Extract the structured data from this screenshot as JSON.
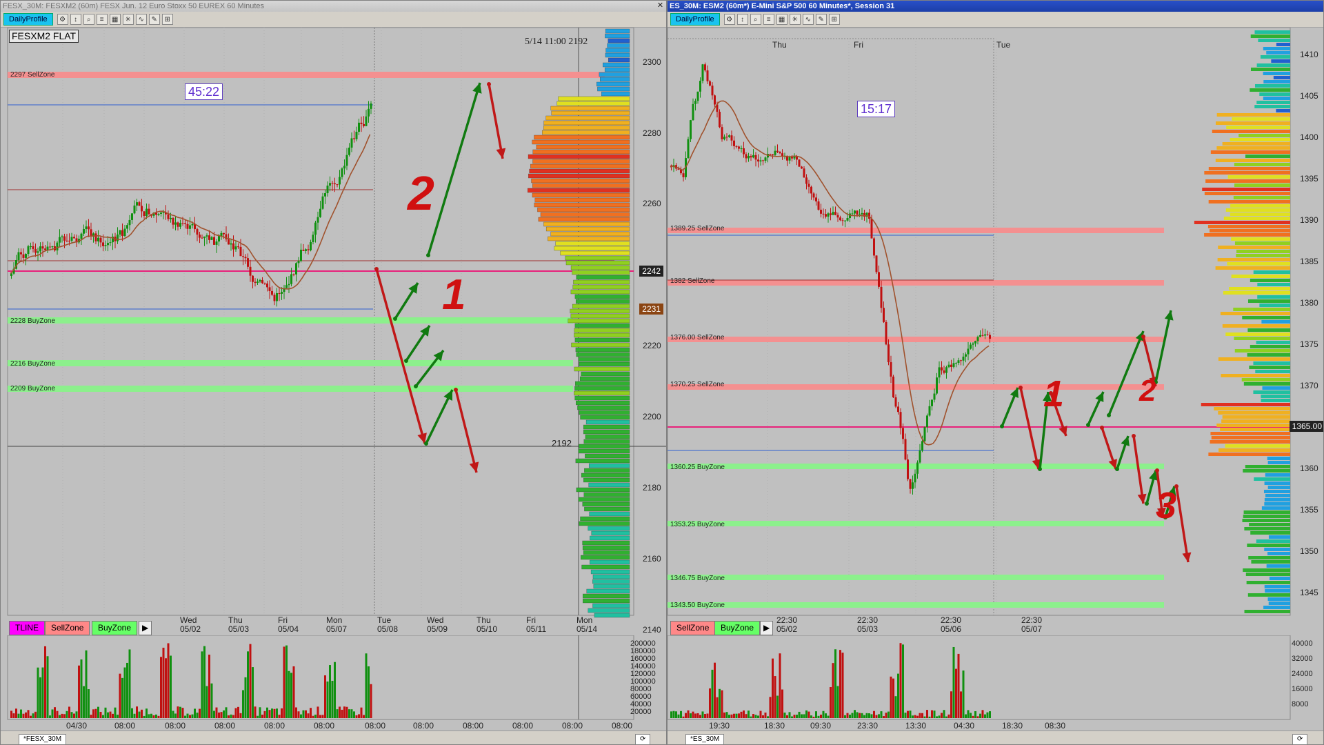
{
  "left": {
    "title": "FESX_30M: FESXM2 (60m) FESX Jun. 12 Euro Stoxx 50 EUREX 60 Minutes",
    "profile_button": "DailyProfile",
    "symbol_label": "FESXM2 FLAT",
    "countdown": "45:22",
    "cursor_readout": "5/14 11:00  2192",
    "cursor_price": "2192",
    "current_price_tag": "2242",
    "secondary_price_tag": "2231",
    "axis_ticks": [
      "2300",
      "2280",
      "2260",
      "2240",
      "2220",
      "2200",
      "2180",
      "2160",
      "2140"
    ],
    "zones": [
      {
        "label": "2297 SellZone",
        "kind": "sell"
      },
      {
        "label": "2228 BuyZone",
        "kind": "buy"
      },
      {
        "label": "2216 BuyZone",
        "kind": "buy"
      },
      {
        "label": "2209 BuyZone",
        "kind": "buy"
      }
    ],
    "date_labels": [
      {
        "day": "Wed",
        "date": "05/02"
      },
      {
        "day": "Thu",
        "date": "05/03"
      },
      {
        "day": "Fri",
        "date": "05/04"
      },
      {
        "day": "Mon",
        "date": "05/07"
      },
      {
        "day": "Tue",
        "date": "05/08"
      },
      {
        "day": "Wed",
        "date": "05/09"
      },
      {
        "day": "Thu",
        "date": "05/10"
      },
      {
        "day": "Fri",
        "date": "05/11"
      },
      {
        "day": "Mon",
        "date": "05/14"
      }
    ],
    "buttons": [
      "TLINE",
      "SellZone",
      "BuyZone"
    ],
    "volume_ticks": [
      "200000",
      "180000",
      "160000",
      "140000",
      "120000",
      "100000",
      "80000",
      "60000",
      "40000",
      "20000"
    ],
    "time_labels": [
      "04/30",
      "08:00",
      "08:00",
      "08:00",
      "08:00",
      "08:00",
      "08:00",
      "08:00",
      "08:00",
      "08:00",
      "08:00",
      "08:00",
      "08:00"
    ],
    "tab_label": "*FESX_30M",
    "annotations": [
      "2",
      "1"
    ]
  },
  "right": {
    "title": "ES_30M: ESM2 (60m*) E-Mini S&P 500 60 Minutes*, Session 31",
    "profile_button": "DailyProfile",
    "countdown": "15:17",
    "current_price_tag": "1365.00",
    "axis_ticks": [
      "1410",
      "1405",
      "1400",
      "1395",
      "1390",
      "1385",
      "1380",
      "1375",
      "1370",
      "1365",
      "1360",
      "1355",
      "1350",
      "1345"
    ],
    "day_labels": [
      "Thu",
      "Fri",
      "Tue"
    ],
    "zones": [
      {
        "label": "1389.25 SellZone",
        "kind": "sell"
      },
      {
        "label": "1382 SellZone",
        "kind": "sell"
      },
      {
        "label": "1376.00 SellZone",
        "kind": "sell"
      },
      {
        "label": "1370.25 SellZone",
        "kind": "sell"
      },
      {
        "label": "1360.25 BuyZone",
        "kind": "buy"
      },
      {
        "label": "1353.25 BuyZone",
        "kind": "buy"
      },
      {
        "label": "1346.75 BuyZone",
        "kind": "buy"
      },
      {
        "label": "1343.50 BuyZone",
        "kind": "buy"
      }
    ],
    "date_labels": [
      {
        "time": "22:30",
        "date": "05/02"
      },
      {
        "time": "22:30",
        "date": "05/03"
      },
      {
        "time": "22:30",
        "date": "05/06"
      },
      {
        "time": "22:30",
        "date": "05/07"
      }
    ],
    "buttons": [
      "SellZone",
      "BuyZone"
    ],
    "volume_ticks": [
      "40000",
      "32000",
      "24000",
      "16000",
      "8000"
    ],
    "time_labels": [
      "19:30",
      "18:30",
      "09:30",
      "23:30",
      "13:30",
      "04:30",
      "18:30",
      "08:30"
    ],
    "tab_label": "*ES_30M",
    "annotations": [
      "1",
      "2",
      "3"
    ]
  },
  "colors": {
    "sell_zone": "#f49090",
    "buy_zone": "#8cf08c",
    "current_price_line": "#e8207a",
    "moving_average": "#a0522d",
    "up_candle": "#109010",
    "down_candle": "#c01010",
    "annotation_green": "#107a10",
    "annotation_red": "#c01818"
  }
}
